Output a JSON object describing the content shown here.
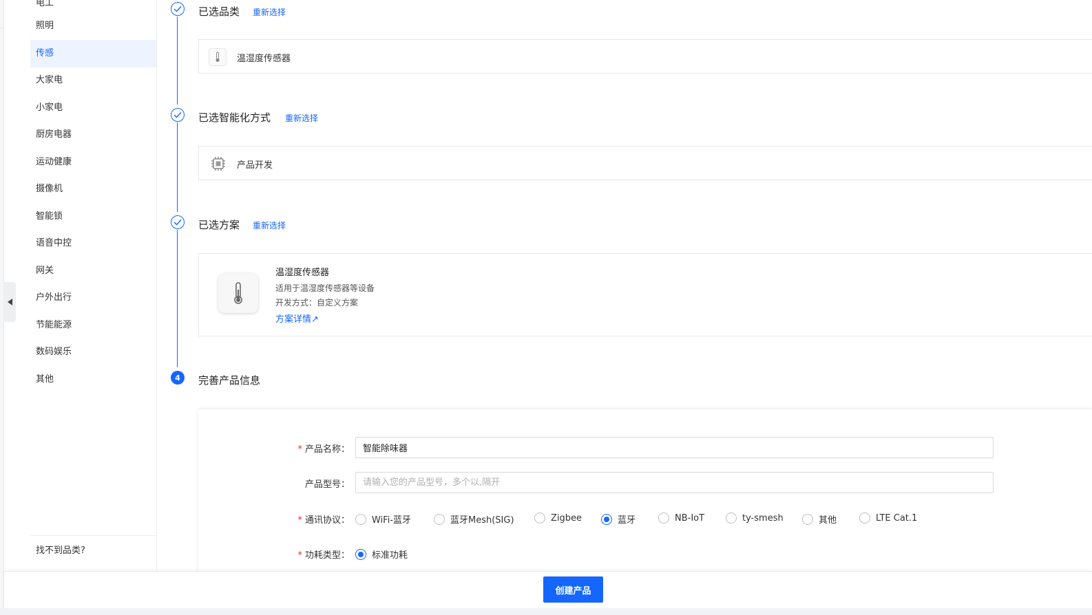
{
  "sidebar": {
    "partial_top": "电工",
    "items": [
      {
        "label": "照明"
      },
      {
        "label": "传感",
        "active": true
      },
      {
        "label": "大家电"
      },
      {
        "label": "小家电"
      },
      {
        "label": "厨房电器"
      },
      {
        "label": "运动健康"
      },
      {
        "label": "摄像机"
      },
      {
        "label": "智能锁"
      },
      {
        "label": "语音中控"
      },
      {
        "label": "网关"
      },
      {
        "label": "户外出行"
      },
      {
        "label": "节能能源"
      },
      {
        "label": "数码娱乐"
      },
      {
        "label": "其他"
      }
    ],
    "not_found": "找不到品类?"
  },
  "steps": {
    "category": {
      "title": "已选品类",
      "reselect": "重新选择",
      "selected": "温湿度传感器",
      "icon": "thermometer-icon"
    },
    "method": {
      "title": "已选智能化方式",
      "reselect": "重新选择",
      "selected": "产品开发",
      "icon": "chip-icon"
    },
    "solution": {
      "title": "已选方案",
      "reselect": "重新选择",
      "name": "温湿度传感器",
      "desc": "适用于温湿度传感器等设备",
      "dev_mode": "开发方式：自定义方案",
      "details_link": "方案详情↗",
      "icon": "thermometer-icon"
    },
    "info": {
      "number": "4",
      "title": "完善产品信息"
    }
  },
  "form": {
    "name_label": "产品名称：",
    "name_value": "智能除味器",
    "model_label": "产品型号：",
    "model_placeholder": "请输入您的产品型号，多个以,隔开",
    "protocol_label": "通讯协议：",
    "protocols": [
      {
        "label": "WiFi-蓝牙",
        "checked": false
      },
      {
        "label": "蓝牙Mesh(SIG)",
        "checked": false
      },
      {
        "label": "Zigbee",
        "checked": false
      },
      {
        "label": "蓝牙",
        "checked": true
      },
      {
        "label": "NB-IoT",
        "checked": false
      },
      {
        "label": "ty-smesh",
        "checked": false
      },
      {
        "label": "其他",
        "checked": false
      },
      {
        "label": "LTE Cat.1",
        "checked": false
      }
    ],
    "power_label": "功耗类型：",
    "power_options": [
      {
        "label": "标准功耗",
        "checked": true
      }
    ]
  },
  "footer": {
    "create_button": "创建产品"
  },
  "colors": {
    "primary": "#1466ff",
    "required": "#f5222d",
    "active_bg": "#eef4ff"
  }
}
